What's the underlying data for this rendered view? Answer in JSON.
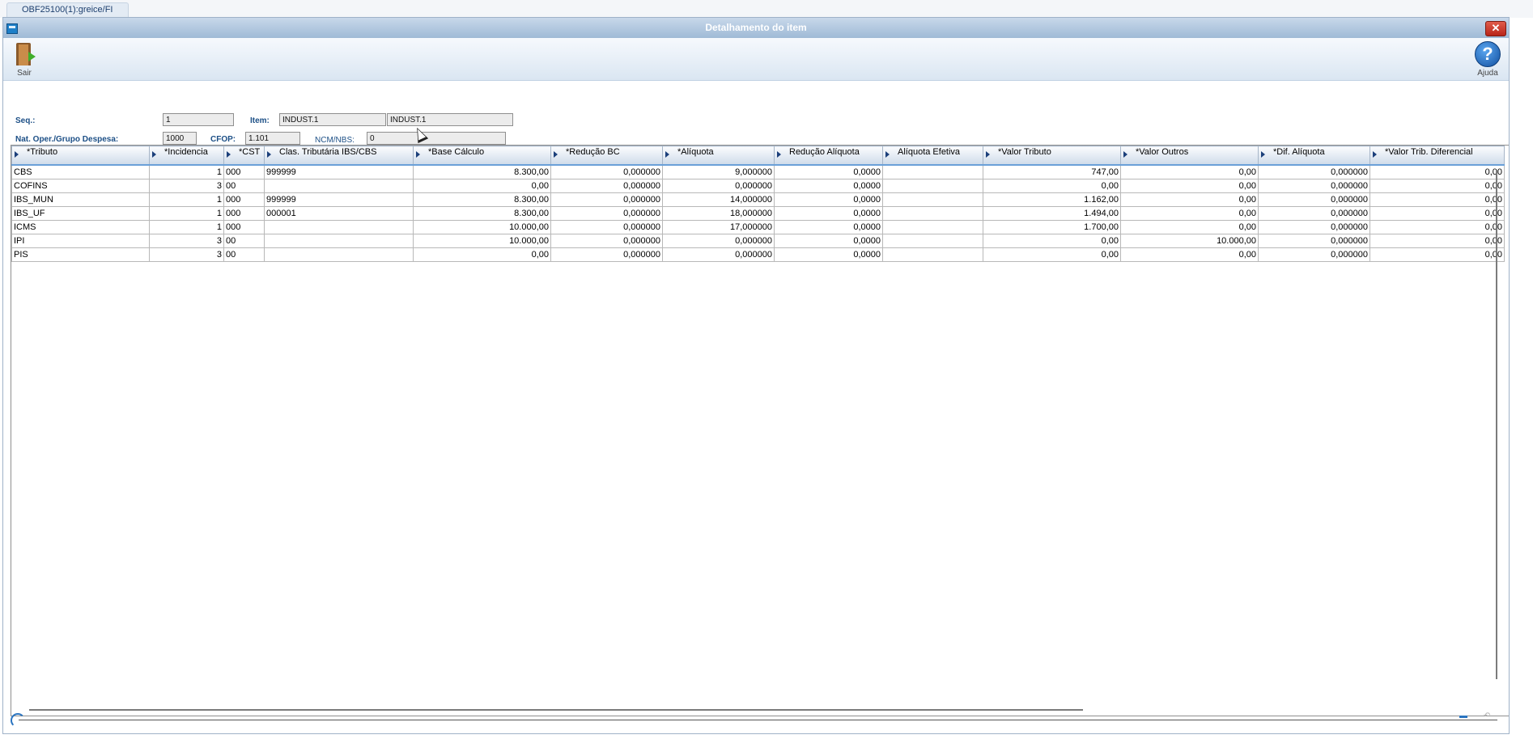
{
  "tab": {
    "label": "OBF25100(1):greice/FI"
  },
  "window": {
    "title": "Detalhamento do item",
    "close": "✕"
  },
  "toolbar": {
    "exit_label": "Sair",
    "help_label": "Ajuda"
  },
  "form": {
    "seq_label": "Seq.:",
    "seq_value": "1",
    "item_label": "Item:",
    "item_code": "INDUST.1",
    "item_desc": "INDUST.1",
    "natop_label": "Nat. Oper./Grupo Despesa:",
    "natop_value": "1000",
    "cfop_label": "CFOP:",
    "cfop_value": "1.101",
    "ncm_label": "NCM/NBS:",
    "ncm_value": "0"
  },
  "grid": {
    "columns": [
      "*Tributo",
      "*Incidencia",
      "*CST",
      "Clas. Tributária IBS/CBS",
      "*Base Cálculo",
      "*Redução BC",
      "*Alíquota",
      "Redução Alíquota",
      "Alíquota Efetiva",
      "*Valor Tributo",
      "*Valor Outros",
      "*Dif. Alíquota",
      "*Valor Trib. Diferencial"
    ],
    "rows": [
      [
        "CBS",
        "1",
        "000",
        "999999",
        "8.300,00",
        "0,000000",
        "9,000000",
        "0,0000",
        "",
        "747,00",
        "0,00",
        "0,000000",
        "0,00"
      ],
      [
        "COFINS",
        "3",
        "00",
        "",
        "0,00",
        "0,000000",
        "0,000000",
        "0,0000",
        "",
        "0,00",
        "0,00",
        "0,000000",
        "0,00"
      ],
      [
        "IBS_MUN",
        "1",
        "000",
        "999999",
        "8.300,00",
        "0,000000",
        "14,000000",
        "0,0000",
        "",
        "1.162,00",
        "0,00",
        "0,000000",
        "0,00"
      ],
      [
        "IBS_UF",
        "1",
        "000",
        "000001",
        "8.300,00",
        "0,000000",
        "18,000000",
        "0,0000",
        "",
        "1.494,00",
        "0,00",
        "0,000000",
        "0,00"
      ],
      [
        "ICMS",
        "1",
        "000",
        "",
        "10.000,00",
        "0,000000",
        "17,000000",
        "0,0000",
        "",
        "1.700,00",
        "0,00",
        "0,000000",
        "0,00"
      ],
      [
        "IPI",
        "3",
        "00",
        "",
        "10.000,00",
        "0,000000",
        "0,000000",
        "0,0000",
        "",
        "0,00",
        "10.000,00",
        "0,000000",
        "0,00"
      ],
      [
        "PIS",
        "3",
        "00",
        "",
        "0,00",
        "0,000000",
        "0,000000",
        "0,0000",
        "",
        "0,00",
        "0,00",
        "0,000000",
        "0,00"
      ]
    ],
    "numeric_columns": [
      1,
      4,
      5,
      6,
      7,
      9,
      10,
      11,
      12
    ]
  }
}
